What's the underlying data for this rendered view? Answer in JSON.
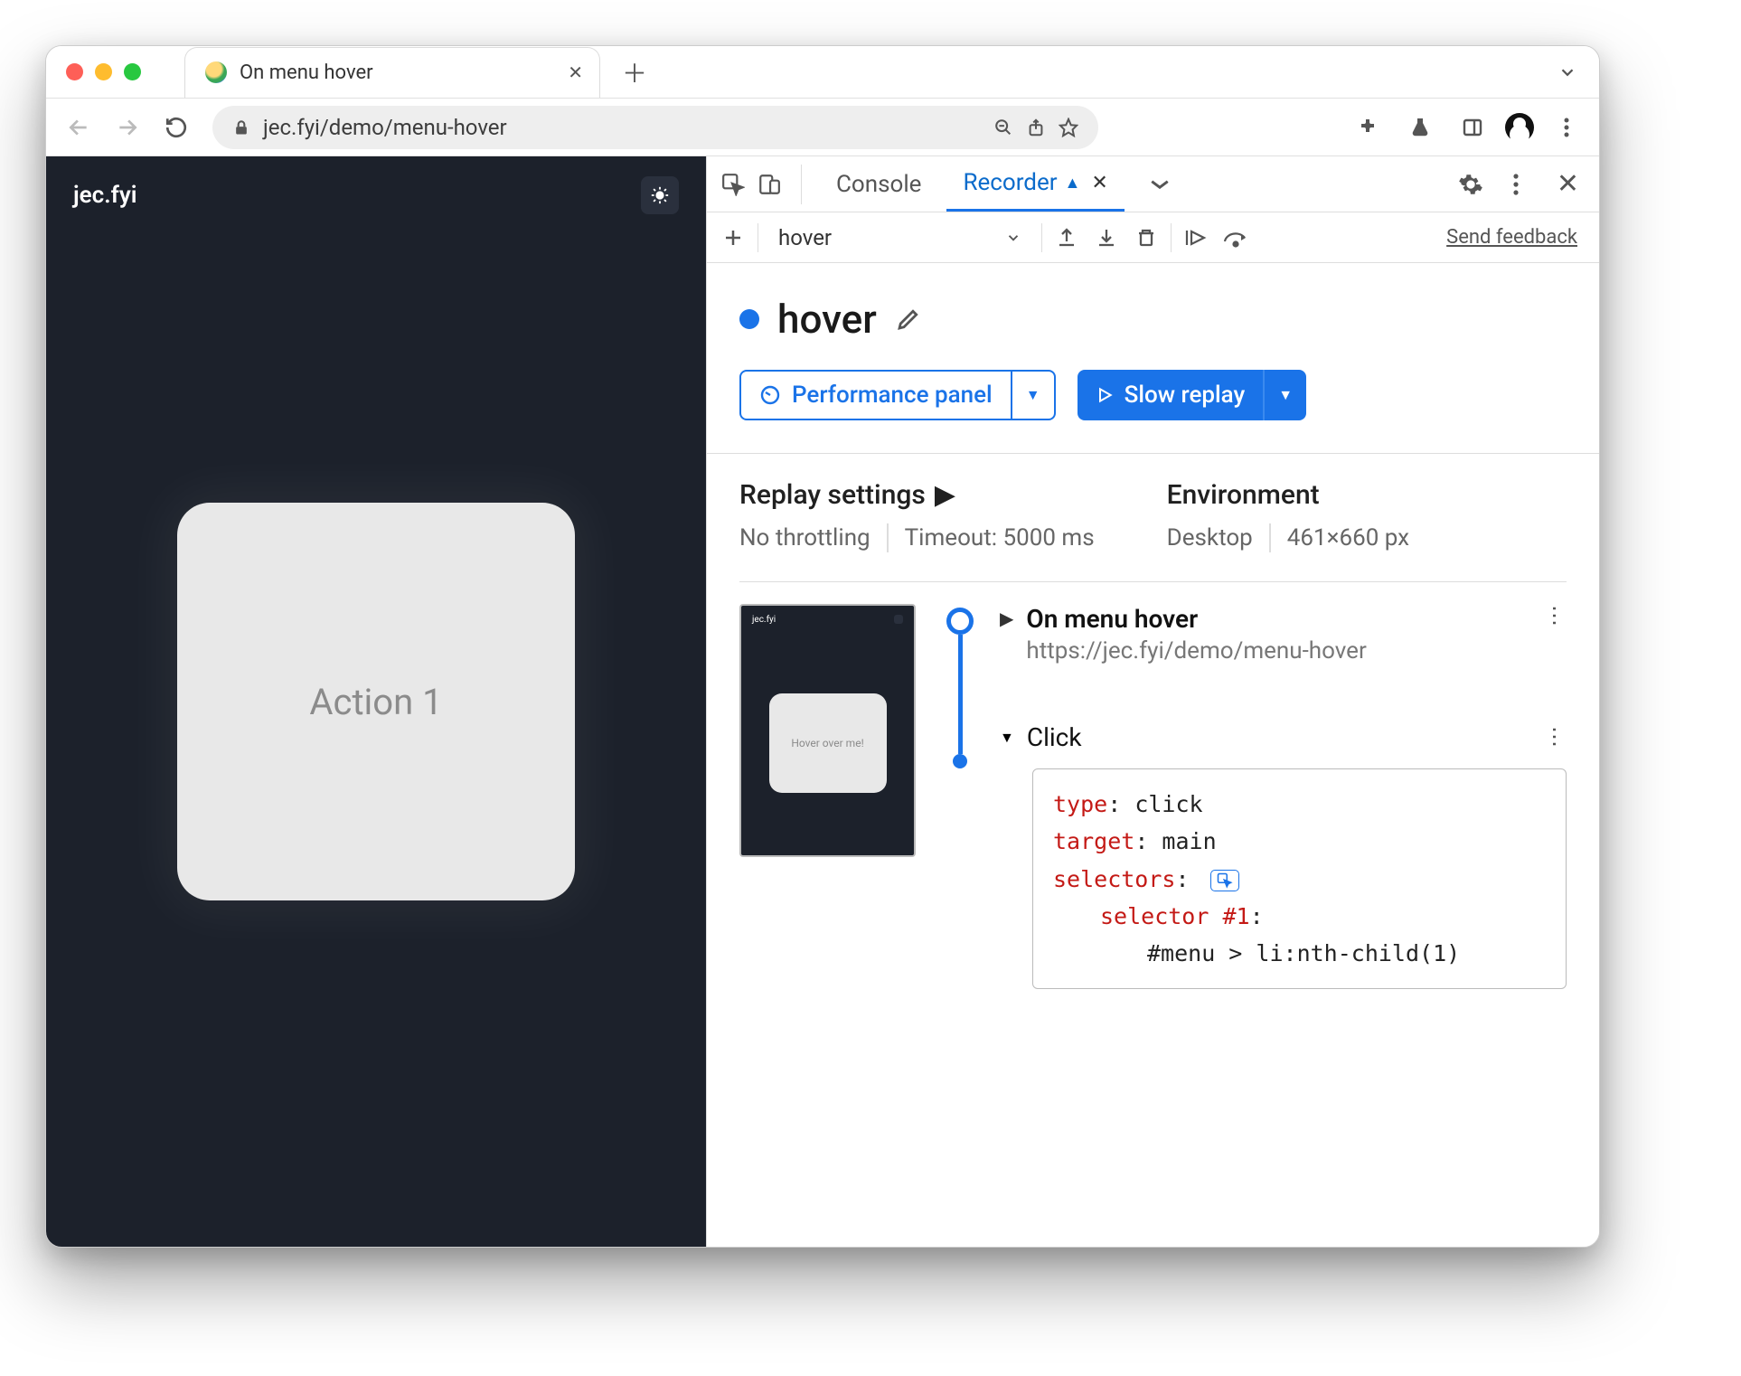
{
  "browser": {
    "tab_title": "On menu hover",
    "url": "jec.fyi/demo/menu-hover"
  },
  "site": {
    "brand": "jec.fyi",
    "card_text": "Action 1"
  },
  "devtools": {
    "tabs": {
      "console": "Console",
      "recorder": "Recorder"
    },
    "toolbar": {
      "dropdown": "hover",
      "feedback": "Send feedback"
    },
    "recording": {
      "name": "hover",
      "perf_button": "Performance panel",
      "replay_button": "Slow replay"
    },
    "settings": {
      "replay_heading": "Replay settings",
      "throttling": "No throttling",
      "timeout": "Timeout: 5000 ms",
      "env_heading": "Environment",
      "device": "Desktop",
      "viewport": "461×660 px"
    },
    "steps": {
      "thumb_text": "Hover over me!",
      "thumb_brand": "jec.fyi",
      "nav_title": "On menu hover",
      "nav_url": "https://jec.fyi/demo/menu-hover",
      "click_title": "Click",
      "code": {
        "k_type": "type",
        "v_type": "click",
        "k_target": "target",
        "v_target": "main",
        "k_selectors": "selectors",
        "k_selector1": "selector #1",
        "v_selector1": "#menu > li:nth-child(1)"
      }
    }
  }
}
